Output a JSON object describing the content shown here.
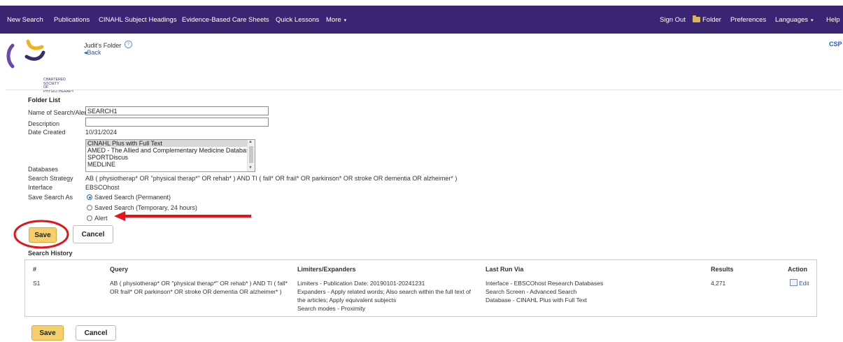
{
  "topnav": {
    "left": [
      "New Search",
      "Publications",
      "CINAHL Subject Headings",
      "Evidence-Based Care Sheets",
      "Quick Lessons",
      "More"
    ],
    "right": [
      "Sign Out",
      "Folder",
      "Preferences",
      "Languages",
      "Help"
    ]
  },
  "logo": {
    "line1": "CHARTERED",
    "line2": "SOCIETY",
    "line3": "OF",
    "line4": "PHYSIOTHERAPY"
  },
  "header": {
    "folder_title": "Judit's Folder",
    "help": "?",
    "back": "Back",
    "csp": "CSP"
  },
  "form": {
    "section_title": "Folder List",
    "name_label": "Name of Search/Alert",
    "name_value": "SEARCH1",
    "description_label": "Description",
    "description_value": "",
    "date_label": "Date Created",
    "date_value": "10/31/2024",
    "databases_label": "Databases",
    "databases": [
      "CINAHL Plus with Full Text",
      "AMED - The Allied and Complementary Medicine Database",
      "SPORTDiscus",
      "MEDLINE"
    ],
    "strategy_label": "Search Strategy",
    "strategy_value": "AB ( physiotherap* OR \"physical therap*\" OR rehab* ) AND TI ( fall* OR frail* OR parkinson* OR stroke OR dementia OR alzheimer* )",
    "interface_label": "Interface",
    "interface_value": "EBSCOhost",
    "save_as_label": "Save Search As",
    "save_options": [
      "Saved Search (Permanent)",
      "Saved Search (Temporary, 24 hours)",
      "Alert"
    ],
    "save_selected": "Saved Search (Permanent)"
  },
  "buttons": {
    "save": "Save",
    "cancel": "Cancel"
  },
  "history": {
    "title": "Search History",
    "headers": [
      "#",
      "Query",
      "Limiters/Expanders",
      "Last Run Via",
      "Results",
      "Action"
    ],
    "row": {
      "id": "S1",
      "query_1": "AB ( physiotherap* OR \"physical therap*\" OR rehab* ) AND TI ( fall*",
      "query_2": "OR frail* OR parkinson* OR stroke OR dementia OR alzheimer* )",
      "limiters_1": "Limiters - Publication Date: 20190101-20241231",
      "limiters_2": "Expanders - Apply related words; Also search within the full text of",
      "limiters_3": "the articles; Apply equivalent subjects",
      "limiters_4": "Search modes - Proximity",
      "lastrun_1": "Interface - EBSCOhost Research Databases",
      "lastrun_2": "Search Screen - Advanced Search",
      "lastrun_3": "Database - CINAHL Plus with Full Text",
      "results": "4,271",
      "action": "Edit"
    }
  },
  "colors": {
    "topbar": "#3b2572",
    "save_button": "#f5cf6b",
    "annotation": "#e0161b",
    "link": "#2a5db0"
  }
}
